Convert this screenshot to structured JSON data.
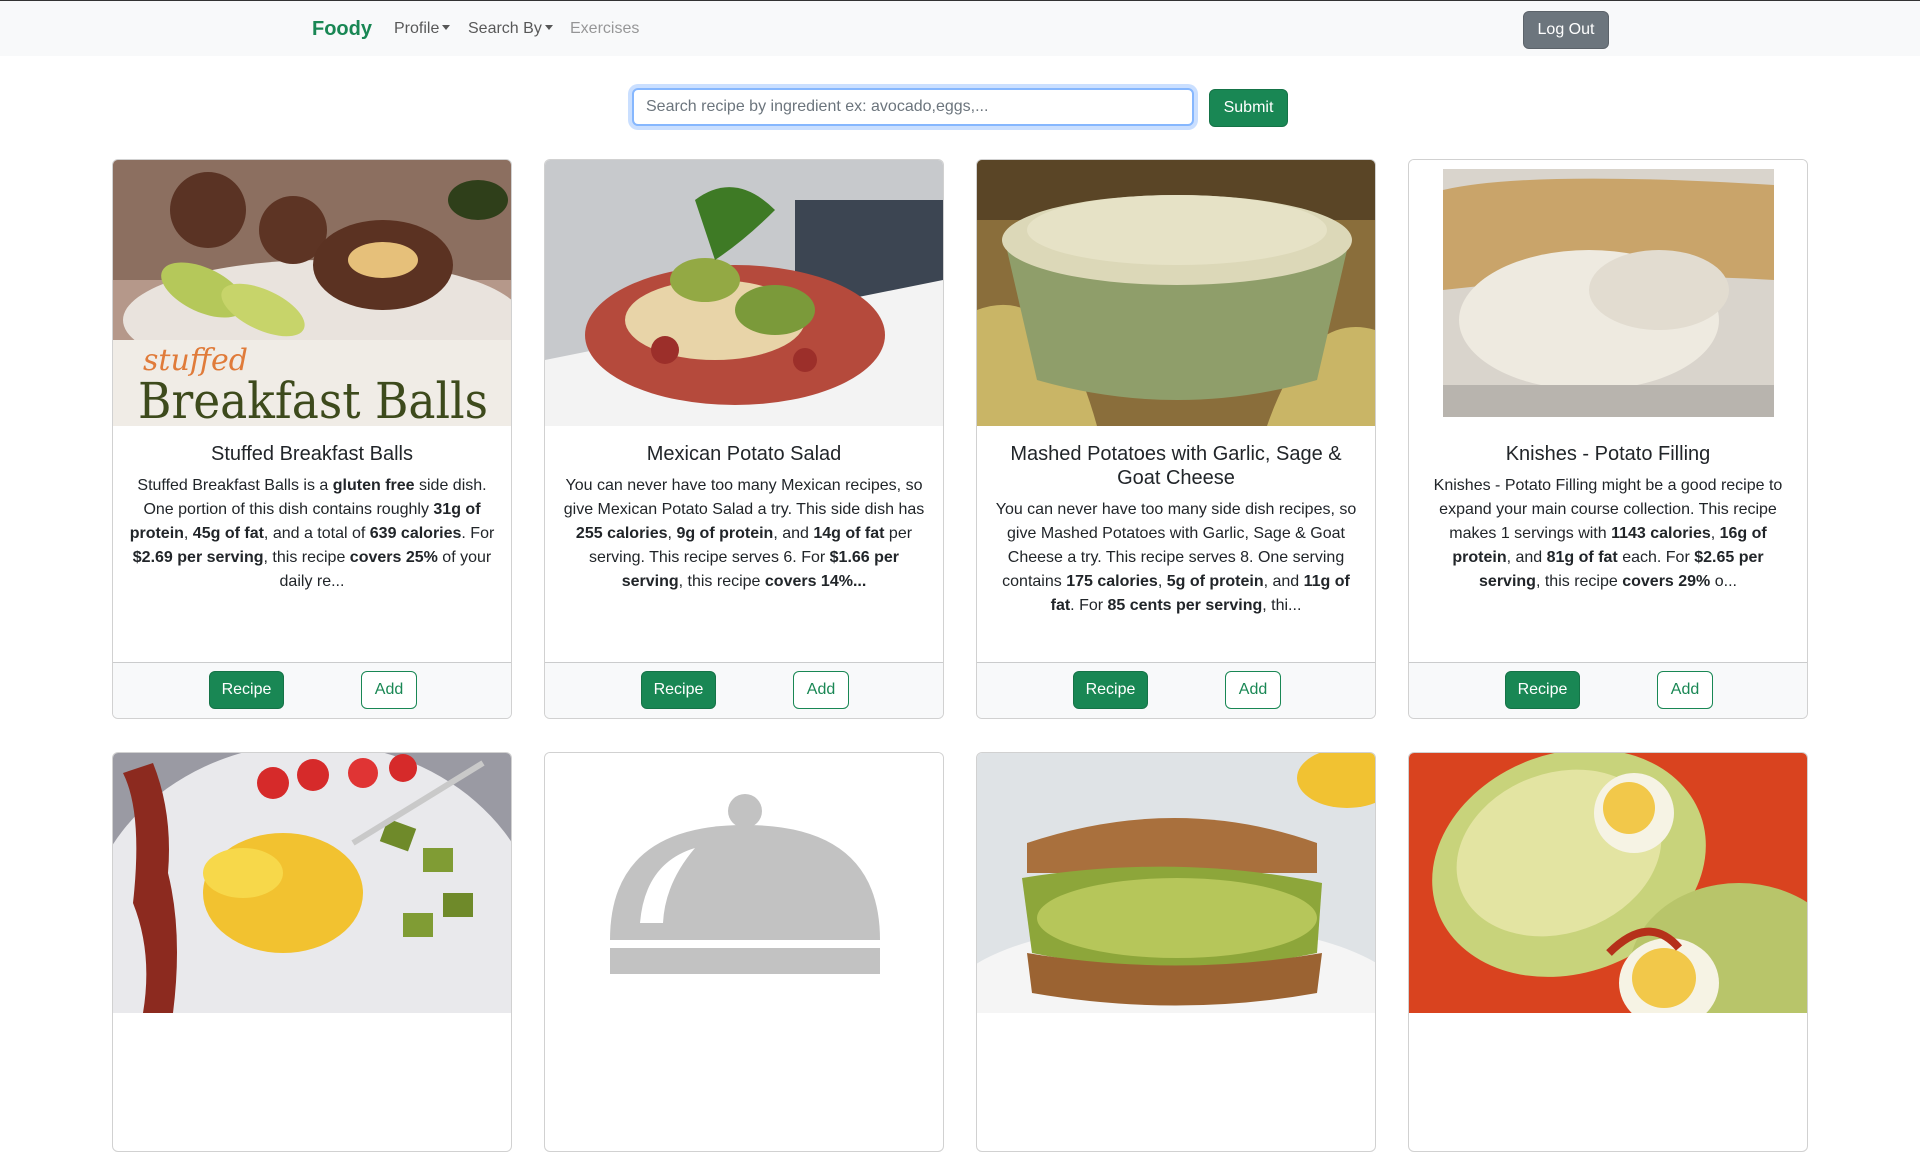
{
  "navbar": {
    "brand": "Foody",
    "links": [
      {
        "label": "Profile",
        "dropdown": true
      },
      {
        "label": "Search By",
        "dropdown": true
      },
      {
        "label": "Exercises",
        "dropdown": false
      }
    ],
    "logout_label": "Log Out"
  },
  "search": {
    "placeholder": "Search recipe by ingredient ex: avocado,eggs,...",
    "value": "",
    "submit_label": "Submit"
  },
  "recipes": [
    {
      "title": "Stuffed Breakfast Balls",
      "image_caption_small": "stuffed",
      "image_caption_large": "Breakfast Balls",
      "description_parts": [
        {
          "t": "Stuffed Breakfast Balls is a ",
          "b": false
        },
        {
          "t": "gluten free",
          "b": true
        },
        {
          "t": " side dish. One portion of this dish contains roughly ",
          "b": false
        },
        {
          "t": "31g of protein",
          "b": true
        },
        {
          "t": ", ",
          "b": false
        },
        {
          "t": "45g of fat",
          "b": true
        },
        {
          "t": ", and a total of ",
          "b": false
        },
        {
          "t": "639 calories",
          "b": true
        },
        {
          "t": ". For ",
          "b": false
        },
        {
          "t": "$2.69 per serving",
          "b": true
        },
        {
          "t": ", this recipe ",
          "b": false
        },
        {
          "t": "covers 25%",
          "b": true
        },
        {
          "t": " of your daily re...",
          "b": false
        }
      ],
      "recipe_label": "Recipe",
      "add_label": "Add"
    },
    {
      "title": "Mexican Potato Salad",
      "description_parts": [
        {
          "t": "You can never have too many Mexican recipes, so give Mexican Potato Salad a try. This side dish has ",
          "b": false
        },
        {
          "t": "255 calories",
          "b": true
        },
        {
          "t": ", ",
          "b": false
        },
        {
          "t": "9g of protein",
          "b": true
        },
        {
          "t": ", and ",
          "b": false
        },
        {
          "t": "14g of fat",
          "b": true
        },
        {
          "t": " per serving. This recipe serves 6. For ",
          "b": false
        },
        {
          "t": "$1.66 per serving",
          "b": true
        },
        {
          "t": ", this recipe ",
          "b": false
        },
        {
          "t": "covers 14%...",
          "b": true
        }
      ],
      "recipe_label": "Recipe",
      "add_label": "Add"
    },
    {
      "title": "Mashed Potatoes with Garlic, Sage & Goat Cheese",
      "description_parts": [
        {
          "t": "You can never have too many side dish recipes, so give Mashed Potatoes with Garlic, Sage & Goat Cheese a try. This recipe serves 8. One serving contains ",
          "b": false
        },
        {
          "t": "175 calories",
          "b": true
        },
        {
          "t": ", ",
          "b": false
        },
        {
          "t": "5g of protein",
          "b": true
        },
        {
          "t": ", and ",
          "b": false
        },
        {
          "t": "11g of fat",
          "b": true
        },
        {
          "t": ". For ",
          "b": false
        },
        {
          "t": "85 cents per serving",
          "b": true
        },
        {
          "t": ", thi...",
          "b": false
        }
      ],
      "recipe_label": "Recipe",
      "add_label": "Add"
    },
    {
      "title": "Knishes - Potato Filling",
      "description_parts": [
        {
          "t": "Knishes - Potato Filling might be a good recipe to expand your main course collection. This recipe makes 1 servings with ",
          "b": false
        },
        {
          "t": "1143 calories",
          "b": true
        },
        {
          "t": ", ",
          "b": false
        },
        {
          "t": "16g of protein",
          "b": true
        },
        {
          "t": ", and ",
          "b": false
        },
        {
          "t": "81g of fat",
          "b": true
        },
        {
          "t": " each. For ",
          "b": false
        },
        {
          "t": "$2.65 per serving",
          "b": true
        },
        {
          "t": ", this recipe ",
          "b": false
        },
        {
          "t": "covers 29%",
          "b": true
        },
        {
          "t": " o...",
          "b": false
        }
      ],
      "recipe_label": "Recipe",
      "add_label": "Add"
    }
  ],
  "second_row_images": [
    "bacon-eggs-avocado-photo",
    "placeholder-cloche-icon",
    "egg-salad-sandwich-photo",
    "deviled-egg-avocado-photo"
  ],
  "colors": {
    "primary": "#198754",
    "secondary": "#6c757d",
    "navbar_bg": "#f8f9fa"
  }
}
